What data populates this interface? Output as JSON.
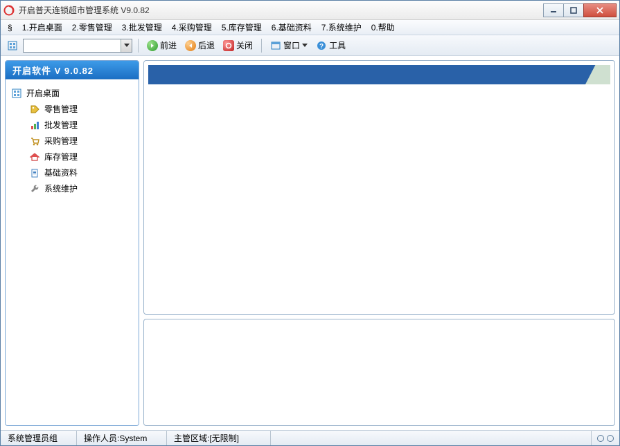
{
  "window": {
    "title": "开启普天连锁超市管理系统 V9.0.82"
  },
  "menu": {
    "section": "§",
    "items": [
      "1.开启桌面",
      "2.零售管理",
      "3.批发管理",
      "4.采购管理",
      "5.库存管理",
      "6.基础资料",
      "7.系统维护",
      "0.帮助"
    ]
  },
  "toolbar": {
    "forward": "前进",
    "back": "后退",
    "close": "关闭",
    "window": "窗口",
    "tools": "工具"
  },
  "sidebar": {
    "header": "开启软件  V 9.0.82",
    "root": "开启桌面",
    "items": [
      {
        "label": "零售管理",
        "icon": "tags"
      },
      {
        "label": "批发管理",
        "icon": "bars"
      },
      {
        "label": "采购管理",
        "icon": "cart"
      },
      {
        "label": "库存管理",
        "icon": "home"
      },
      {
        "label": "基础资料",
        "icon": "doc"
      },
      {
        "label": "系统维护",
        "icon": "wrench"
      }
    ]
  },
  "status": {
    "group": "系统管理员组",
    "operator": "操作人员:System",
    "region": "主管区域:[无限制]"
  }
}
